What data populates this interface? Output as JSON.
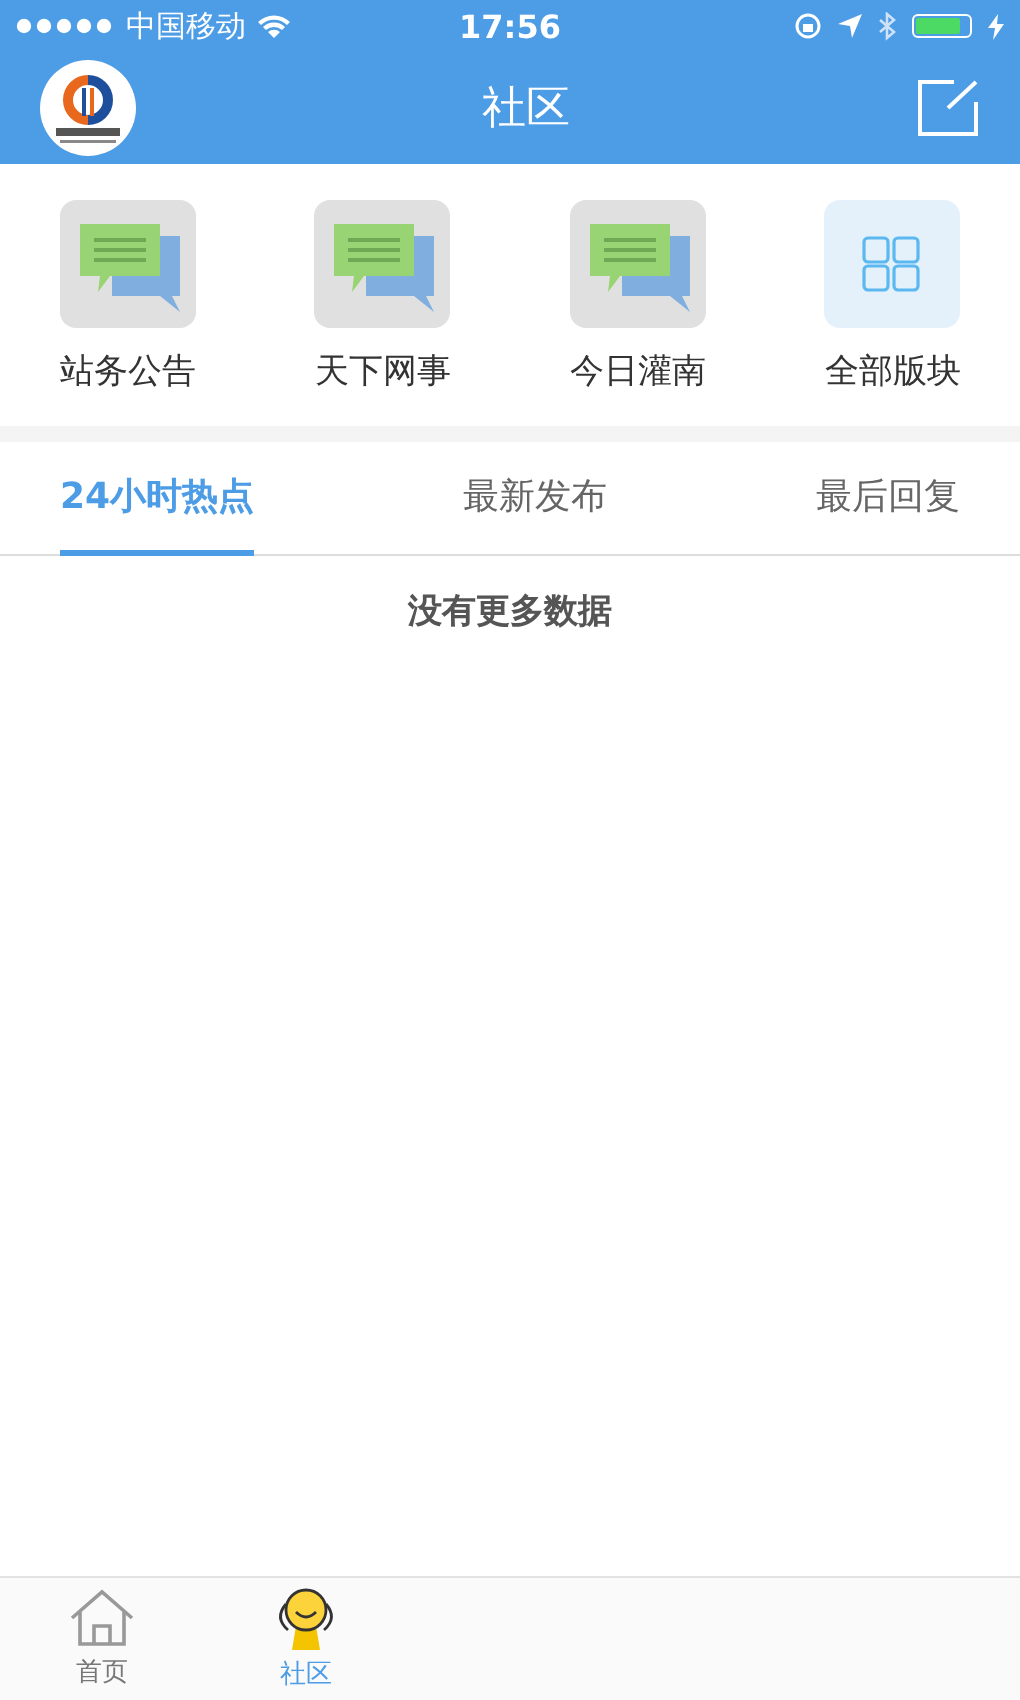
{
  "status_bar": {
    "carrier": "中国移动",
    "time": "17:56"
  },
  "nav_bar": {
    "title": "社区"
  },
  "sections": [
    {
      "label": "站务公告",
      "kind": "forum"
    },
    {
      "label": "天下网事",
      "kind": "forum"
    },
    {
      "label": "今日灌南",
      "kind": "forum"
    },
    {
      "label": "全部版块",
      "kind": "all"
    }
  ],
  "tabs": [
    {
      "label": "24小时热点",
      "selected": true
    },
    {
      "label": "最新发布",
      "selected": false
    },
    {
      "label": "最后回复",
      "selected": false
    }
  ],
  "empty_message": "没有更多数据",
  "tab_bar": [
    {
      "label": "首页",
      "kind": "home",
      "selected": false
    },
    {
      "label": "社区",
      "kind": "community",
      "selected": true
    }
  ]
}
